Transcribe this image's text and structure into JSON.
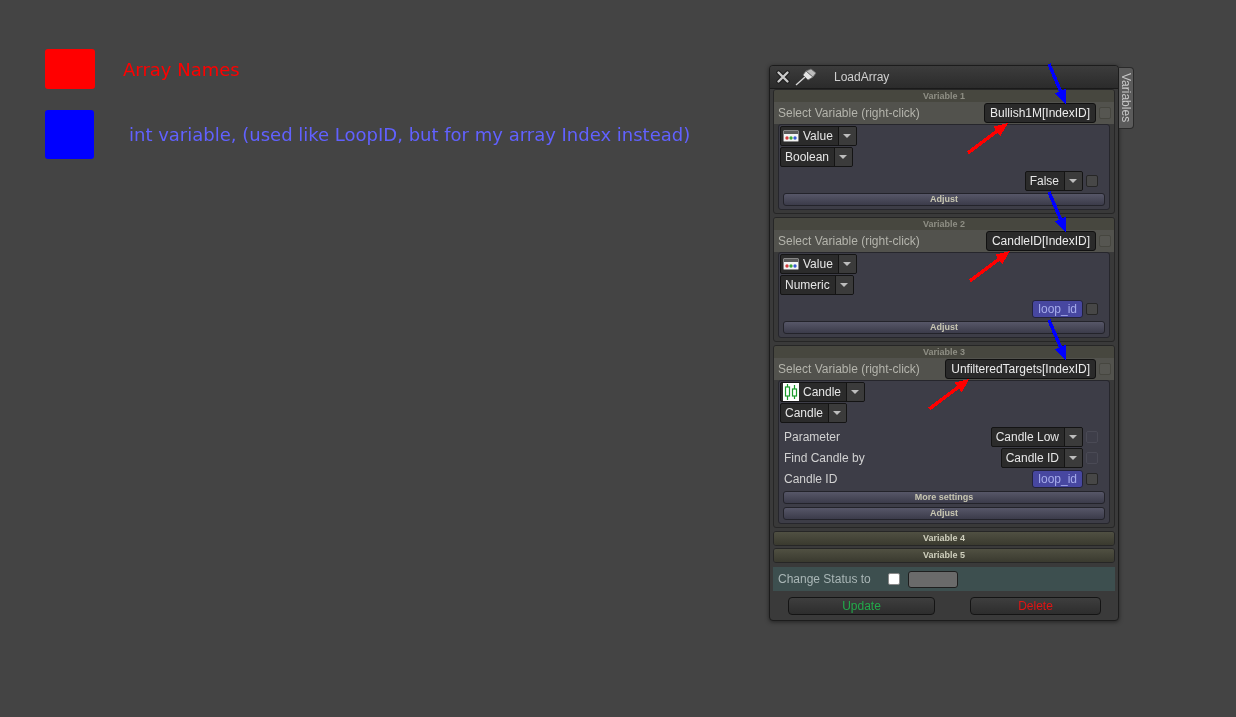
{
  "legend": [
    {
      "label": "Array Names",
      "color": "#ff0000"
    },
    {
      "label": "int variable, (used like LoopID, but for my array Index instead)",
      "color": "#0000ff"
    }
  ],
  "window": {
    "title": "LoadArray",
    "side_tab": "Variables"
  },
  "variables": [
    {
      "header": "Variable 1",
      "expanded": true,
      "select_label": "Select Variable (right-click)",
      "name": "Bullish1M[IndexID]",
      "checked": false,
      "source": {
        "kind": "value",
        "label": "Value"
      },
      "type": "Boolean",
      "settings": [
        {
          "kind": "dropdown",
          "value": "False",
          "checked": false,
          "disabled": false
        }
      ],
      "buttons": [
        "Adjust"
      ],
      "arrows": [
        {
          "kind": "index",
          "color": "#0000ff"
        },
        {
          "kind": "array_name",
          "color": "#ff0000"
        }
      ]
    },
    {
      "header": "Variable 2",
      "expanded": true,
      "select_label": "Select Variable (right-click)",
      "name": "CandleID[IndexID]",
      "checked": false,
      "source": {
        "kind": "value",
        "label": "Value"
      },
      "type": "Numeric",
      "settings": [
        {
          "kind": "variable",
          "value": "loop_id",
          "checked": false,
          "disabled": false
        }
      ],
      "buttons": [
        "Adjust"
      ],
      "arrows": [
        {
          "kind": "index",
          "color": "#0000ff"
        },
        {
          "kind": "array_name",
          "color": "#ff0000"
        }
      ]
    },
    {
      "header": "Variable 3",
      "expanded": true,
      "select_label": "Select Variable (right-click)",
      "name": "UnfilteredTargets[IndexID]",
      "checked": false,
      "source": {
        "kind": "candle",
        "label": "Candle"
      },
      "type": "Candle",
      "settings": [
        {
          "kind": "dropdown",
          "label": "Parameter",
          "value": "Candle Low",
          "checked": false,
          "disabled": true
        },
        {
          "kind": "dropdown",
          "label": "Find Candle by",
          "value": "Candle ID",
          "checked": false,
          "disabled": true
        },
        {
          "kind": "variable",
          "label": "Candle ID",
          "value": "loop_id",
          "checked": false,
          "disabled": false
        }
      ],
      "buttons": [
        "More settings",
        "Adjust"
      ],
      "arrows": [
        {
          "kind": "index",
          "color": "#0000ff"
        },
        {
          "kind": "array_name",
          "color": "#ff0000"
        }
      ]
    },
    {
      "header": "Variable 4",
      "expanded": false
    },
    {
      "header": "Variable 5",
      "expanded": false
    }
  ],
  "status": {
    "label": "Change Status to",
    "checked": false
  },
  "actions": [
    {
      "kind": "update",
      "label": "Update"
    },
    {
      "kind": "delete",
      "label": "Delete"
    }
  ]
}
